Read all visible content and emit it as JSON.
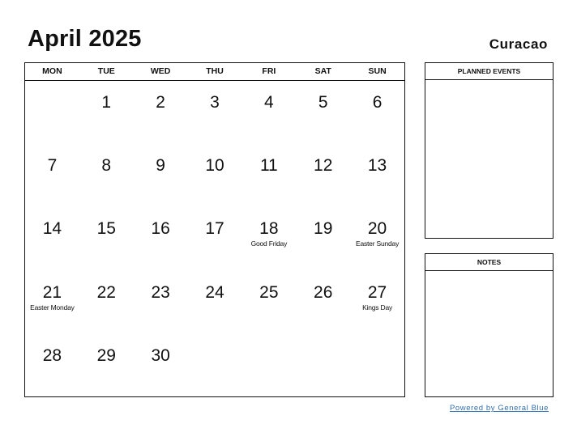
{
  "header": {
    "title": "April 2025",
    "country": "Curacao"
  },
  "weekdays": [
    "MON",
    "TUE",
    "WED",
    "THU",
    "FRI",
    "SAT",
    "SUN"
  ],
  "weeks": [
    [
      {
        "day": ""
      },
      {
        "day": "1"
      },
      {
        "day": "2"
      },
      {
        "day": "3"
      },
      {
        "day": "4"
      },
      {
        "day": "5"
      },
      {
        "day": "6"
      }
    ],
    [
      {
        "day": "7"
      },
      {
        "day": "8"
      },
      {
        "day": "9"
      },
      {
        "day": "10"
      },
      {
        "day": "11"
      },
      {
        "day": "12"
      },
      {
        "day": "13"
      }
    ],
    [
      {
        "day": "14"
      },
      {
        "day": "15"
      },
      {
        "day": "16"
      },
      {
        "day": "17"
      },
      {
        "day": "18",
        "holiday": "Good Friday"
      },
      {
        "day": "19"
      },
      {
        "day": "20",
        "holiday": "Easter Sunday"
      }
    ],
    [
      {
        "day": "21",
        "holiday": "Easter Monday"
      },
      {
        "day": "22"
      },
      {
        "day": "23"
      },
      {
        "day": "24"
      },
      {
        "day": "25"
      },
      {
        "day": "26"
      },
      {
        "day": "27",
        "holiday": "Kings Day"
      }
    ],
    [
      {
        "day": "28"
      },
      {
        "day": "29"
      },
      {
        "day": "30"
      },
      {
        "day": ""
      },
      {
        "day": ""
      },
      {
        "day": ""
      },
      {
        "day": ""
      }
    ]
  ],
  "panels": {
    "planned_events": "PLANNED EVENTS",
    "notes": "NOTES"
  },
  "footer": {
    "link": "Powered by General Blue",
    "color": "#2f6fb5"
  }
}
